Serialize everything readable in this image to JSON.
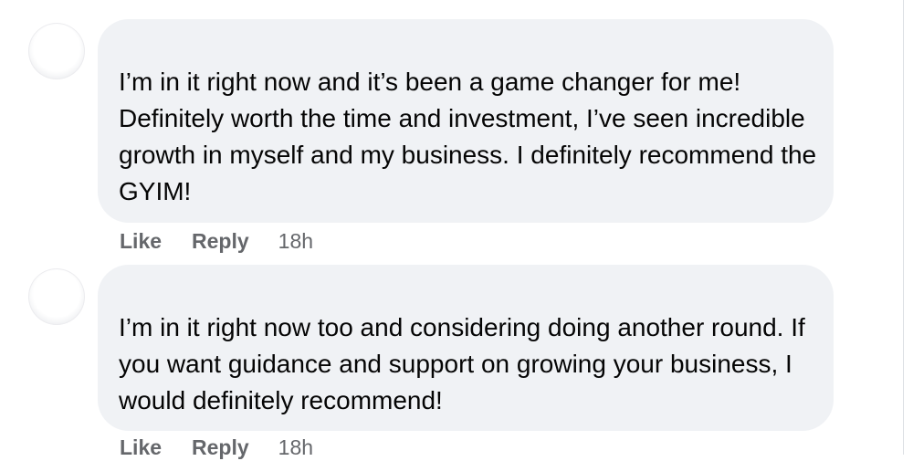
{
  "comments": [
    {
      "text": "I’m in it right now and it’s been a game changer for me! Definitely worth the time and investment, I’ve seen incredible growth in myself and my business. I definitely recommend the GYIM!",
      "actions": {
        "like": "Like",
        "reply": "Reply",
        "time": "18h"
      }
    },
    {
      "text": "I’m in it right now too and considering doing another round. If you want guidance and support on growing your business, I would definitely recommend!",
      "actions": {
        "like": "Like",
        "reply": "Reply",
        "time": "18h"
      }
    }
  ],
  "colors": {
    "bubble_bg": "#f0f2f5",
    "text": "#050505",
    "meta": "#65676b"
  }
}
